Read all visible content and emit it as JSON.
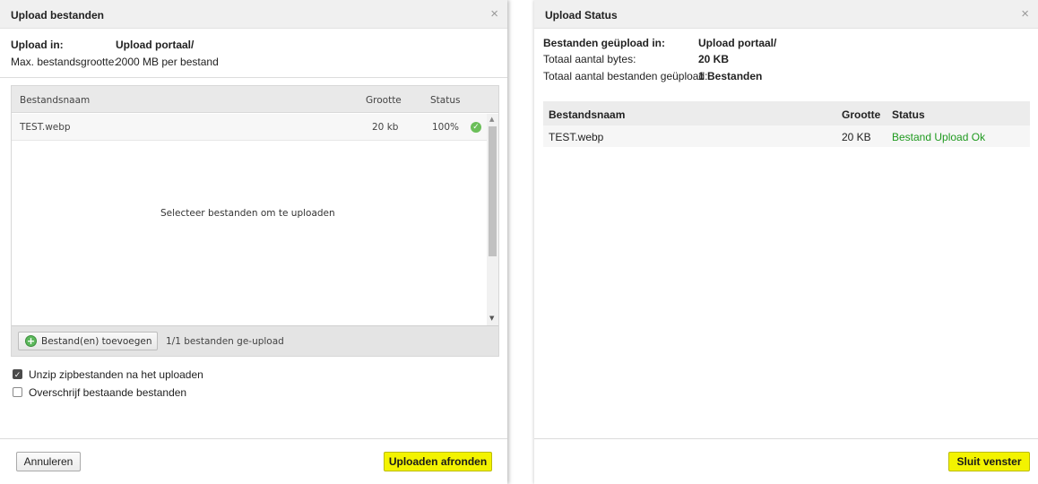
{
  "upload_dialog": {
    "title": "Upload bestanden",
    "close_symbol": "×",
    "upload_in_label": "Upload in:",
    "upload_in_value": "Upload portaal/",
    "max_size_label": "Max. bestandsgrootte:",
    "max_size_value": "2000 MB per bestand",
    "table": {
      "columns": [
        "Bestandsnaam",
        "Grootte",
        "Status"
      ],
      "rows": [
        {
          "name": "TEST.webp",
          "size": "20 kb",
          "status": "100%",
          "status_icon": "check-circle-icon"
        }
      ],
      "empty_hint": "Selecteer bestanden om te uploaden"
    },
    "add_button_label": "Bestand(en) toevoegen",
    "upload_progress_text": "1/1 bestanden ge-upload",
    "options": [
      {
        "label": "Unzip zipbestanden na het uploaden",
        "checked": true
      },
      {
        "label": "Overschrijf bestaande bestanden",
        "checked": false
      }
    ],
    "cancel_label": "Annuleren",
    "finish_label": "Uploaden afronden"
  },
  "status_dialog": {
    "title": "Upload Status",
    "close_symbol": "×",
    "uploaded_in_label": "Bestanden geüpload in:",
    "uploaded_in_value": "Upload portaal/",
    "total_bytes_label": "Totaal aantal bytes:",
    "total_bytes_value": "20 KB",
    "total_files_label": "Totaal aantal bestanden geüpload:",
    "total_files_value": "1 Bestanden",
    "table": {
      "columns": [
        "Bestandsnaam",
        "Grootte",
        "Status"
      ],
      "rows": [
        {
          "name": "TEST.webp",
          "size": "20 KB",
          "status": "Bestand Upload Ok"
        }
      ]
    },
    "close_window_label": "Sluit venster"
  },
  "colors": {
    "primary_button": "#f3f300",
    "success_text": "#1f9a1f",
    "success_icon": "#6bbf59"
  }
}
